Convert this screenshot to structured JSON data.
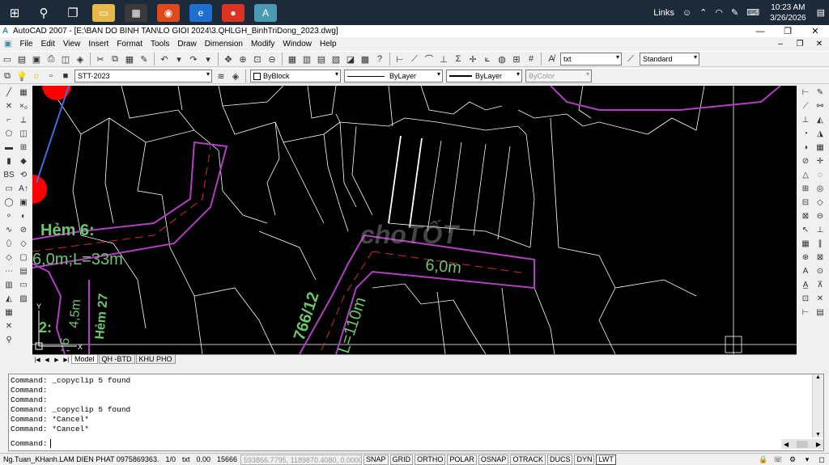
{
  "taskbar": {
    "links_label": "Links",
    "time": "10:23 AM",
    "date": "3/26/2026",
    "apps": [
      {
        "name": "file-explorer",
        "color": "#e8b84a"
      },
      {
        "name": "calculator",
        "color": "#3a3a3a"
      },
      {
        "name": "media-player",
        "color": "#e04a1a"
      },
      {
        "name": "internet-explorer",
        "color": "#1e6fd0"
      },
      {
        "name": "chrome",
        "color": "#dd3322"
      },
      {
        "name": "autocad",
        "color": "#4a9ab0"
      }
    ]
  },
  "window": {
    "title": "AutoCAD 2007 - [E:\\BAN DO BINH TAN\\LO GIOI 2024\\3.QHLGH_BinhTriDong_2023.dwg]"
  },
  "menu": [
    "File",
    "Edit",
    "View",
    "Insert",
    "Format",
    "Tools",
    "Draw",
    "Dimension",
    "Modify",
    "Window",
    "Help"
  ],
  "toolbar": {
    "text_style": "txt",
    "dim_style": "Standard",
    "layer": "STT-2023",
    "color": "ByBlock",
    "linetype": "ByLayer",
    "lineweight": "ByLayer",
    "plotstyle": "ByColor"
  },
  "layout_tabs": [
    "Model",
    "QH -BTD",
    "KHU PHO"
  ],
  "canvas": {
    "labels": {
      "hem6": "Hẻm 6:",
      "hem6_dim": "6,0m;L=33m",
      "road_width": "6,0m",
      "road_766": "766/12",
      "road_len": "L=110m",
      "hem27": "Hẻm 27",
      "dim_4_5": "4,5m",
      "left_2": "2:",
      "left_dim": "; 6",
      "watermark": "choTỐT",
      "ucs_y": "Y",
      "ucs_x": "X"
    }
  },
  "command": {
    "history": [
      "Command: _copyclip 5 found",
      "Command:",
      "Command:",
      "Command: _copyclip 5 found",
      "Command: *Cancel*",
      "Command: *Cancel*"
    ],
    "prompt": "Command:"
  },
  "status": {
    "user": "Ng.Tuan_KHanh.LAM DIEN PHAT 0975869363.",
    "scale": "1/0",
    "style": "txt",
    "elev": "0.00",
    "num": "15666",
    "coords": "593866.7795, 1189870.4080, 0.0000",
    "buttons": [
      {
        "label": "SNAP",
        "on": false
      },
      {
        "label": "GRID",
        "on": false
      },
      {
        "label": "ORTHO",
        "on": false
      },
      {
        "label": "POLAR",
        "on": false
      },
      {
        "label": "OSNAP",
        "on": false
      },
      {
        "label": "OTRACK",
        "on": false
      },
      {
        "label": "DUCS",
        "on": false
      },
      {
        "label": "DYN",
        "on": false
      },
      {
        "label": "LWT",
        "on": true
      }
    ]
  },
  "colors": {
    "canvas_bg": "#000000",
    "parcel_line": "#ffffff",
    "road_outline": "#b040c0",
    "label_green": "#6fc46f",
    "red_marker": "#ff0000",
    "blue_line": "#3a6fd8"
  }
}
